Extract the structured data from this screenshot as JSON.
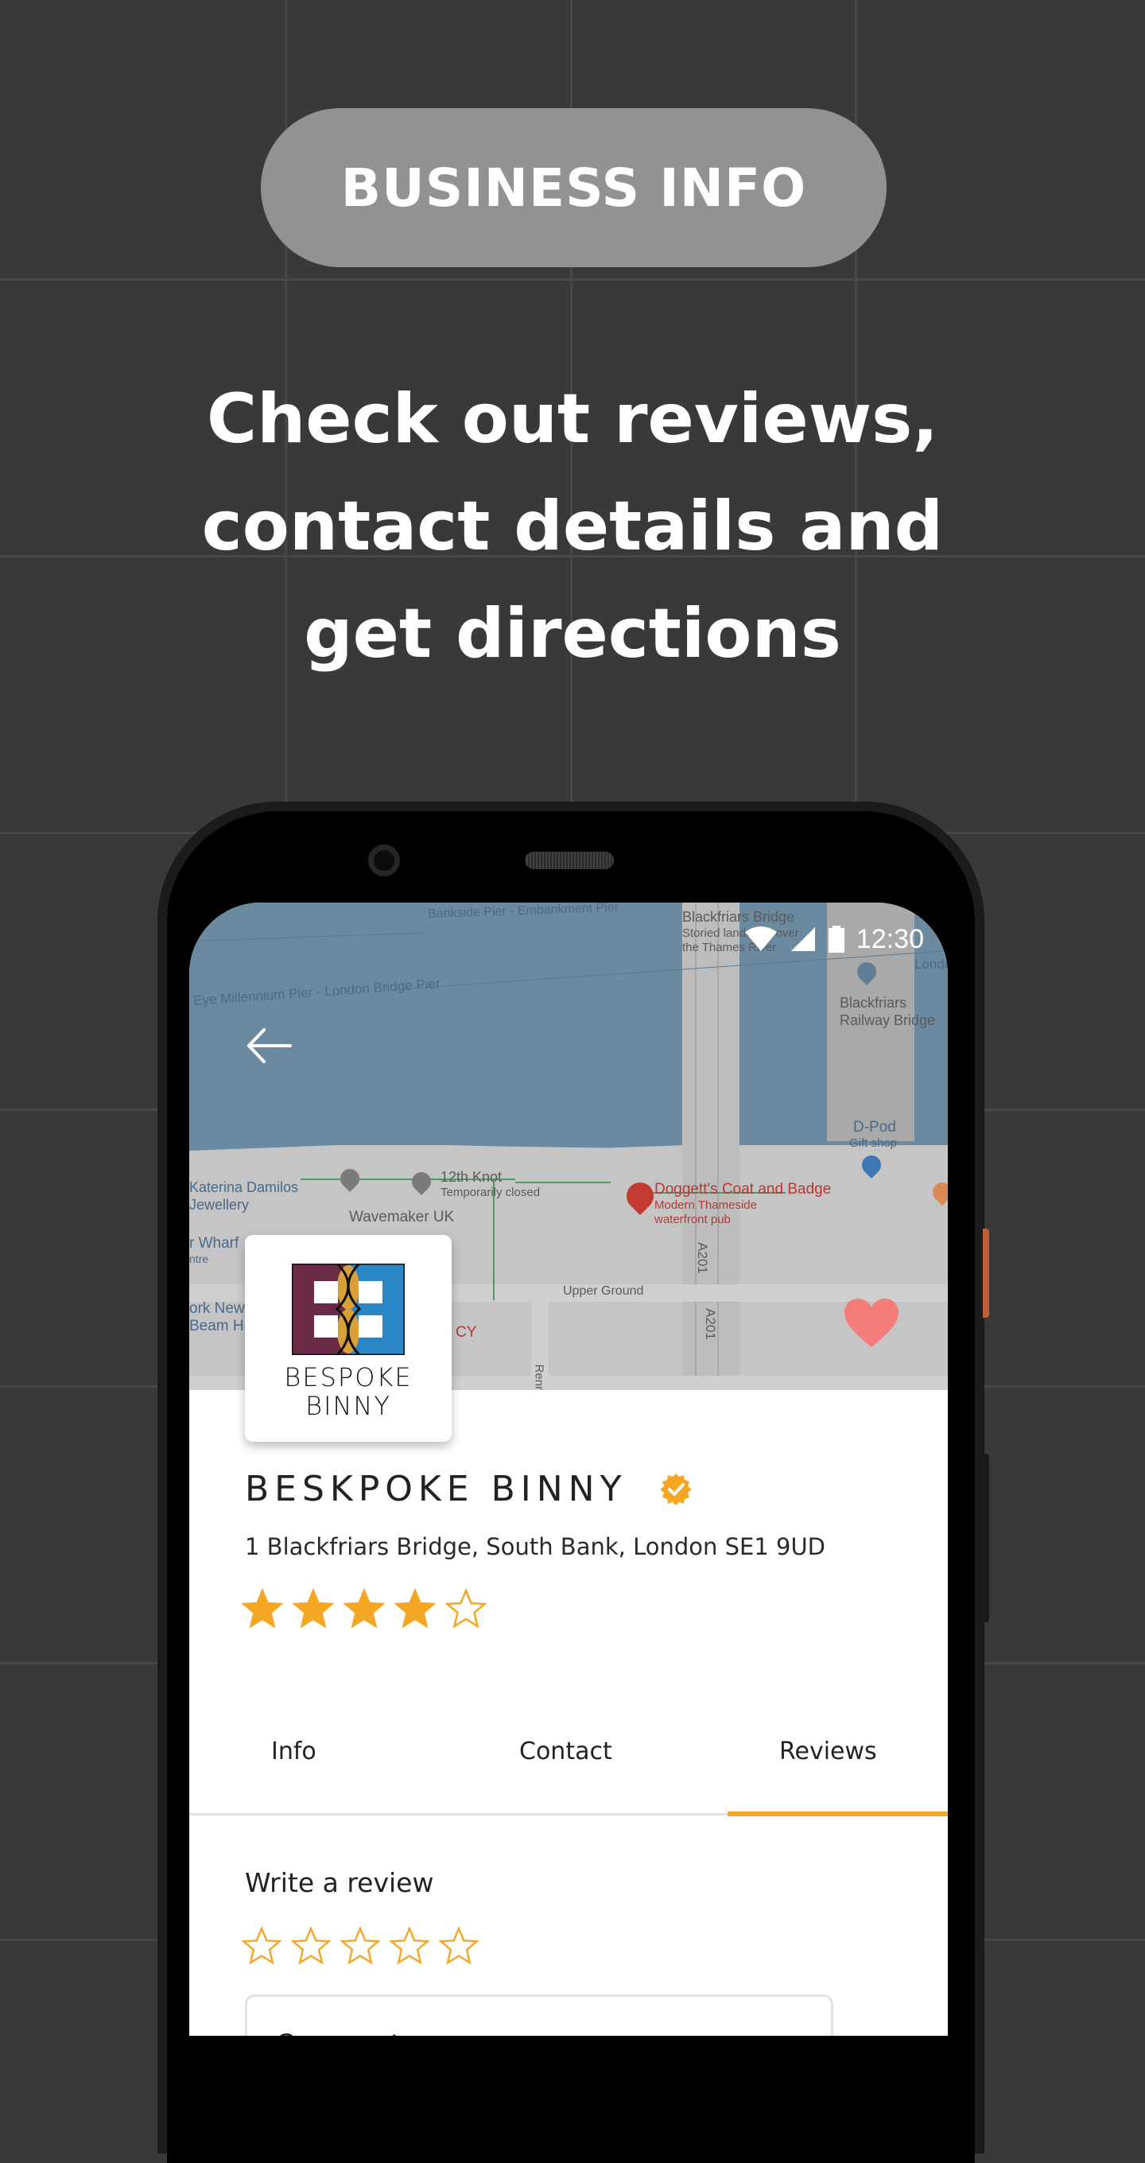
{
  "banner": {
    "label": "BUSINESS INFO"
  },
  "headline": {
    "lines": [
      "Check out reviews,",
      "contact details and",
      "get directions"
    ]
  },
  "status_bar": {
    "time": "12:30",
    "icons": [
      "wifi-icon",
      "cellular-signal-icon",
      "battery-icon"
    ]
  },
  "map": {
    "labels": {
      "bankside_pier": "Bankside Pier - Embankment Pier",
      "eye_pier": "Eye Millennium Pier - London Bridge Pier",
      "blackfriars_bridge": "Blackfriars Bridge",
      "blackfriars_bridge_desc1": "Storied landmark over",
      "blackfriars_bridge_desc2": "the Thames River",
      "london": "Londo",
      "railway_bridge1": "Blackfriars",
      "railway_bridge2": "Railway Bridge",
      "dpod": "D-Pod",
      "dpod_desc": "Gift shop",
      "katerina1": "Katerina Damilos",
      "katerina2": "Jewellery",
      "knot": "12th Knot",
      "knot_desc": "Temporarily closed",
      "doggetts": "Doggett's Coat and Badge",
      "doggetts_desc1": "Modern Thameside",
      "doggetts_desc2": "waterfront pub",
      "wavemaker": "Wavemaker UK",
      "wharf": "r Wharf",
      "wharf_desc": "ntre",
      "york1": "ork New",
      "york2": "Beam Ho",
      "upper_ground": "Upper Ground",
      "a201_1": "A201",
      "a201_2": "A201",
      "cy": "CY",
      "renn": "Renn"
    }
  },
  "business": {
    "logo_text_line1": "BESPOKE",
    "logo_text_line2": "BINNY",
    "name": "BESKPOKE BINNY",
    "verified": true,
    "address": "1 Blackfriars Bridge, South Bank, London SE1 9UD",
    "rating": 4,
    "rating_max": 5,
    "favorited": true
  },
  "tabs": {
    "items": [
      {
        "label": "Info",
        "active": false
      },
      {
        "label": "Contact",
        "active": false
      },
      {
        "label": "Reviews",
        "active": true
      }
    ]
  },
  "review_form": {
    "title": "Write a review",
    "selected_rating": 0,
    "rating_max": 5,
    "comment_placeholder": "Comment",
    "comment_value": ""
  },
  "colors": {
    "accent": "#f5a623",
    "heart": "#f47c7a",
    "background": "#393939",
    "pill": "#929292"
  }
}
